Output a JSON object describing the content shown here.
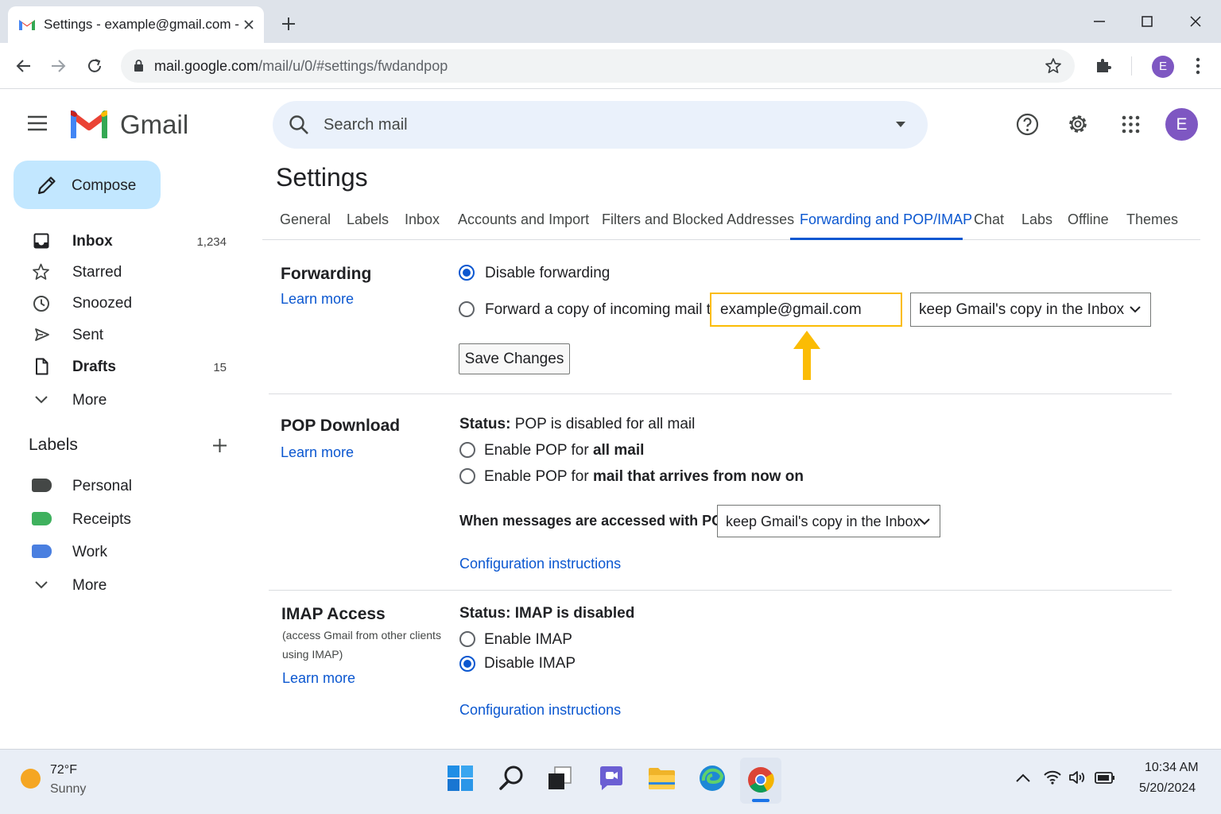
{
  "browser": {
    "tab_title": "Settings - example@gmail.com -",
    "url_host": "mail.google.com",
    "url_path": "/mail/u/0/#settings/fwdandpop",
    "profile_initial": "E"
  },
  "header": {
    "product_name": "Gmail",
    "search_placeholder": "Search mail",
    "account_initial": "E"
  },
  "sidebar": {
    "compose_label": "Compose",
    "items": [
      {
        "label": "Inbox",
        "count": "1,234"
      },
      {
        "label": "Starred",
        "count": ""
      },
      {
        "label": "Snoozed",
        "count": ""
      },
      {
        "label": "Sent",
        "count": ""
      },
      {
        "label": "Drafts",
        "count": "15"
      },
      {
        "label": "More",
        "count": ""
      }
    ],
    "labels_heading": "Labels",
    "labels": [
      {
        "label": "Personal",
        "color": "#444746"
      },
      {
        "label": "Receipts",
        "color": "#3fb15e"
      },
      {
        "label": "Work",
        "color": "#4a7fe0"
      }
    ],
    "labels_more": "More"
  },
  "settings": {
    "title": "Settings",
    "tabs": [
      "General",
      "Labels",
      "Inbox",
      "Accounts and Import",
      "Filters and Blocked Addresses",
      "Forwarding and POP/IMAP",
      "Chat",
      "Labs",
      "Offline",
      "Themes"
    ],
    "active_tab": "Forwarding and POP/IMAP",
    "forwarding": {
      "title": "Forwarding",
      "learn_more": "Learn more",
      "option_disable": "Disable forwarding",
      "option_forward": "Forward a copy of incoming mail to",
      "forward_address": "example@gmail.com",
      "forward_action": "keep Gmail's copy in the Inbox",
      "save_button": "Save Changes",
      "selected": "disable"
    },
    "pop": {
      "title": "POP Download",
      "learn_more": "Learn more",
      "status_label": "Status:",
      "status_value": "POP is disabled for all mail",
      "opt1_prefix": "Enable POP for ",
      "opt1_bold": "all mail",
      "opt2_prefix": "Enable POP for ",
      "opt2_bold": "mail that arrives from now on",
      "access_label": "When messages are accessed with POP",
      "access_value": "keep Gmail's copy in the Inbox",
      "config_link": "Configuration instructions"
    },
    "imap": {
      "title": "IMAP Access",
      "desc": "(access Gmail from other clients using IMAP)",
      "learn_more": "Learn more",
      "status_label": "Status:",
      "status_value": "IMAP is disabled",
      "opt_enable": "Enable IMAP",
      "opt_disable": "Disable IMAP",
      "selected": "disable",
      "config_link": "Configuration instructions"
    }
  },
  "taskbar": {
    "temperature": "72°F",
    "weather": "Sunny",
    "time": "10:34 AM",
    "date": "5/20/2024"
  },
  "colors": {
    "accent_blue": "#0b57d0",
    "highlight_yellow": "#fbbc04",
    "compose_bg": "#c2e7ff",
    "avatar_purple": "#7e57c2"
  }
}
